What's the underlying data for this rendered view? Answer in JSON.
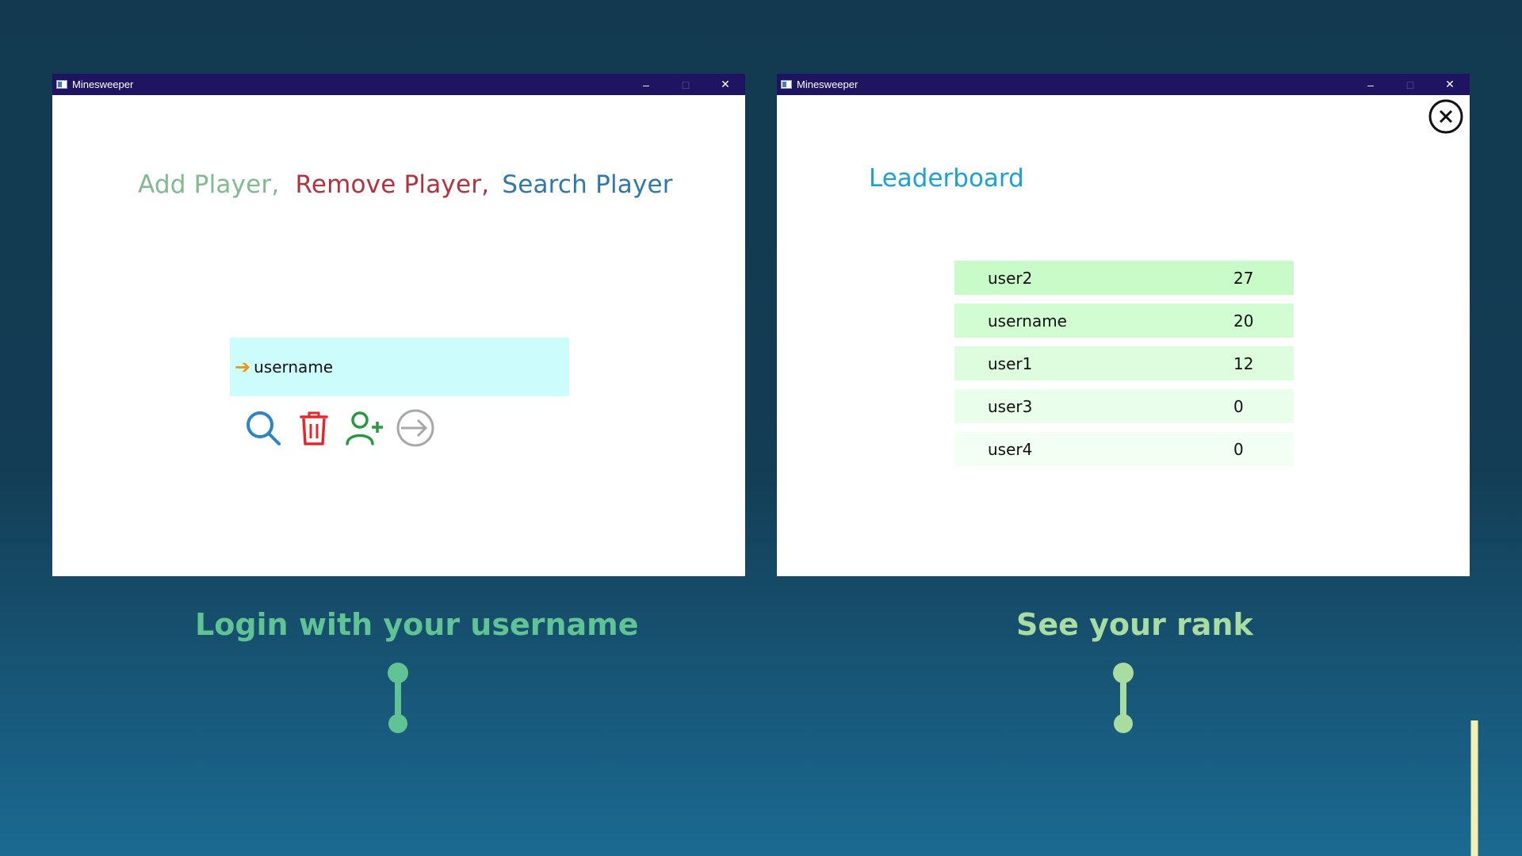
{
  "left_window": {
    "title": "Minesweeper",
    "controls": [
      "–",
      "□",
      "✕"
    ],
    "headline": [
      {
        "text": "Add Player,",
        "color": "#7fba90"
      },
      {
        "text": "Remove Player,",
        "color": "#b5323c"
      },
      {
        "text": "Search Player",
        "color": "#2f78ab"
      }
    ],
    "input": {
      "value": "username",
      "arrow": "➔",
      "arrow_color": "#f29410",
      "bg": "#ccfcfc"
    },
    "icons": [
      {
        "name": "search-icon",
        "color": "#2a83cc"
      },
      {
        "name": "trash-icon",
        "color": "#e3282c"
      },
      {
        "name": "add-user-icon",
        "color": "#269a3e"
      },
      {
        "name": "login-arrow-icon",
        "color": "#a8a8a8"
      }
    ]
  },
  "right_window": {
    "title": "Minesweeper",
    "controls": [
      "–",
      "□",
      "✕"
    ],
    "heading": "Leaderboard",
    "leaderboard": [
      {
        "name": "user2",
        "score": "27",
        "bg": "#c8fbc8"
      },
      {
        "name": "username",
        "score": "20",
        "bg": "#d2fcd2"
      },
      {
        "name": "user1",
        "score": "12",
        "bg": "#defddf"
      },
      {
        "name": "user3",
        "score": "0",
        "bg": "#e9feeb"
      },
      {
        "name": "user4",
        "score": "0",
        "bg": "#f3fff4"
      }
    ]
  },
  "captions": {
    "left": "Login with your username",
    "right": "See your rank"
  },
  "colors": {
    "titlebar": "#1e1461",
    "timeline_start": "#3dae86",
    "timeline_end": "#f3f0b2"
  }
}
